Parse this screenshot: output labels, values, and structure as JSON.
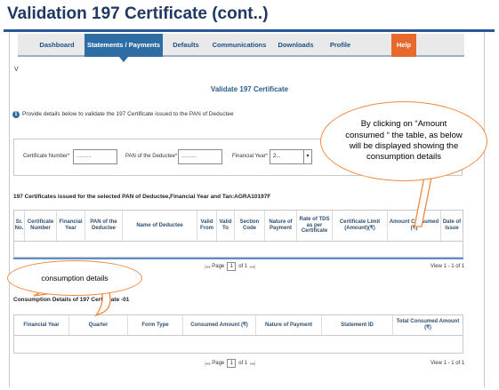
{
  "slide_title": "Validation 197 Certificate  (cont..)",
  "nav": {
    "items": [
      {
        "label": "Dashboard"
      },
      {
        "label": "Statements / Payments"
      },
      {
        "label": "Defaults"
      },
      {
        "label": "Communications"
      },
      {
        "label": "Downloads"
      },
      {
        "label": "Profile"
      }
    ],
    "help_label": "Help",
    "active_item": "Statements / Payments"
  },
  "v_mark": "V",
  "page_heading": "Validate 197 Certificate",
  "info_text": "Provide details below to validate the 197 Certificate issued to the PAN of Deductee",
  "form": {
    "certificate_number_label": "Certificate Number",
    "certificate_number_value": "..........",
    "pan_label": "PAN of the Deductee",
    "pan_value": "..........",
    "fy_label": "Financial Year",
    "fy_value": "2...",
    "required_mark": "*"
  },
  "certificates_section": {
    "title": "197 Certificates issued for the selected PAN of Deductee,Financial Year and Tan:AGRA10197F",
    "columns": [
      "Sr. No.",
      "Certificate Number",
      "Financial Year",
      "PAN of the Deductee",
      "Name of Deductee",
      "Valid From",
      "Valid To",
      "Section Code",
      "Nature of Payment",
      "Rate of TDS as per Certificate",
      "Certificate Limit (Amount)(₹)",
      "Amount Consumed (₹)",
      "Date of Issue"
    ],
    "pager": {
      "page_label": "Page",
      "page_value": "1",
      "of_label": "of 1"
    },
    "view_label": "View 1 - 1 of 1"
  },
  "consumption_section": {
    "title": "Consumption Details of 197 Certificate -01",
    "columns": [
      "Financial Year",
      "Quarter",
      "Form Type",
      "Consumed Amount (₹)",
      "Nature of Payment",
      "Statement ID",
      "Total Consumed Amount (₹)"
    ],
    "pager": {
      "page_label": "Page",
      "page_value": "1",
      "of_label": "of 1"
    },
    "view_label": "View 1 - 1 of 1"
  },
  "callouts": {
    "amount_consumed": "By clicking on “Amount consumed “ the table, as below will be displayed showing the consumption details",
    "consumption_details": "consumption details"
  },
  "colors": {
    "title": "#1f3864",
    "nav_active": "#2e6da4",
    "help": "#e8692e",
    "callout_border": "#f2873d",
    "grid_header_text": "#2f4f6f"
  }
}
